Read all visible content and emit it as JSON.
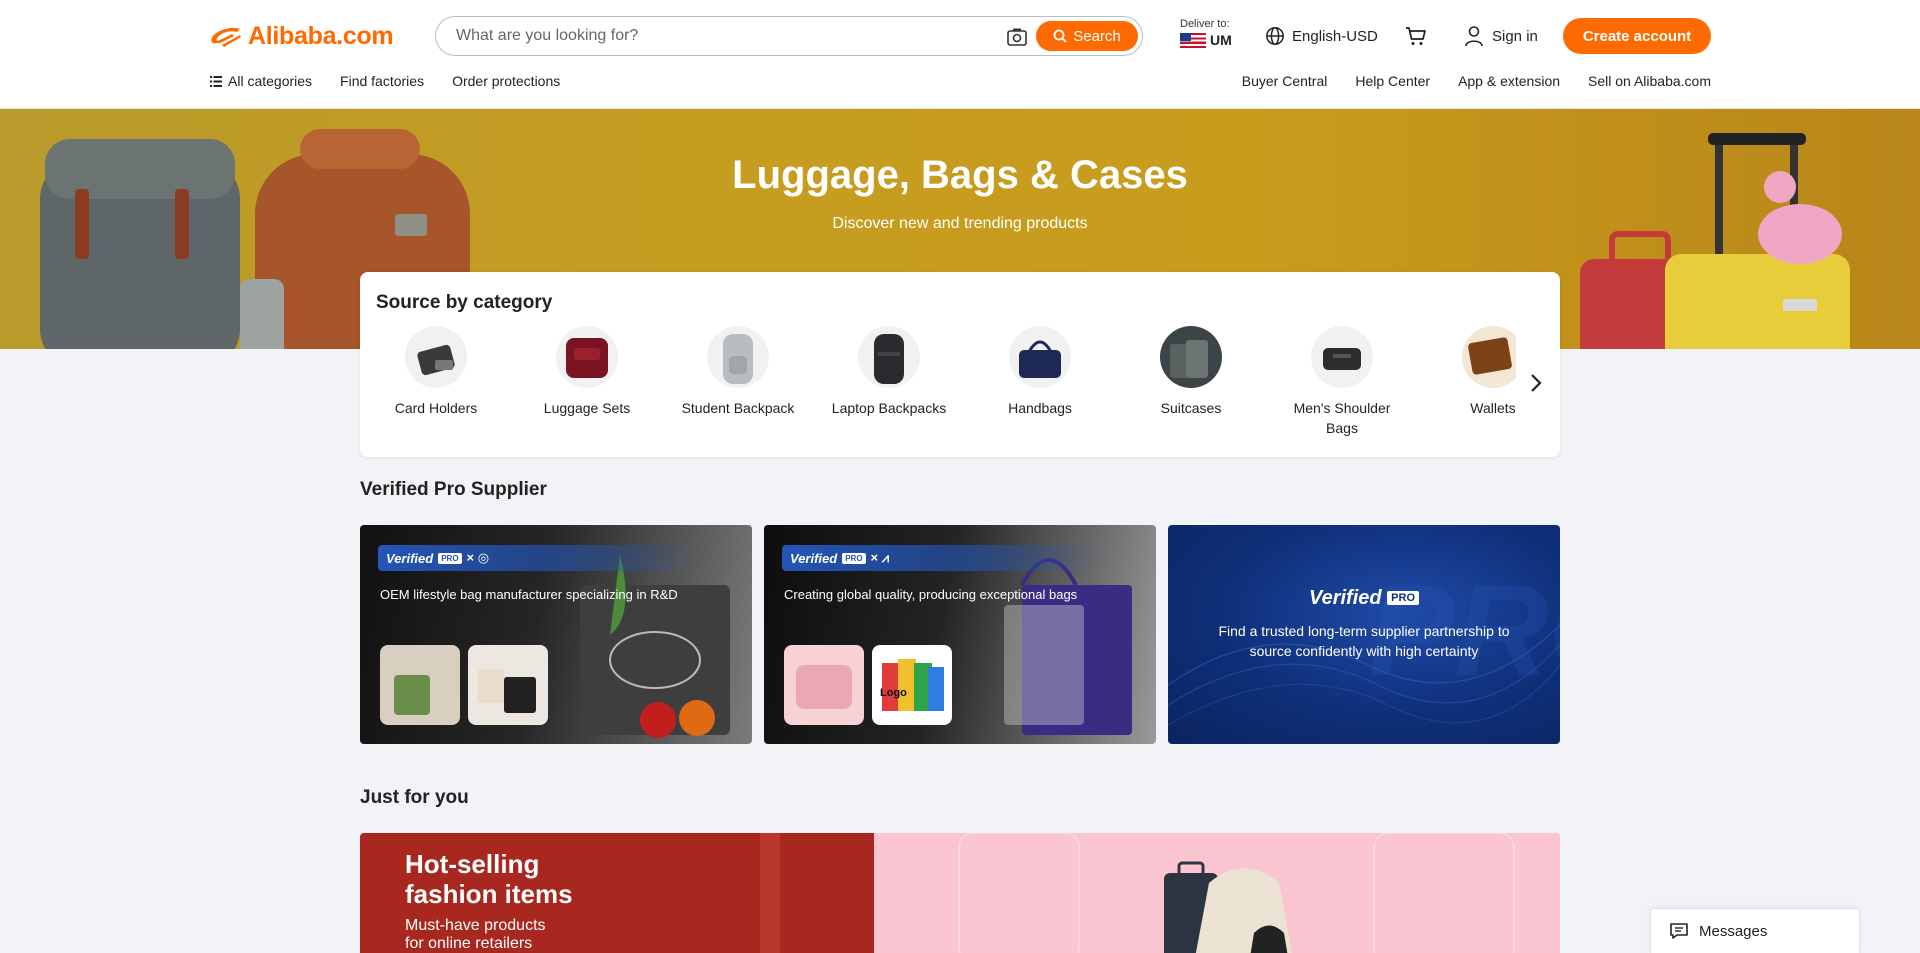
{
  "header": {
    "logo_text": "Alibaba.com",
    "search_placeholder": "What are you looking for?",
    "search_button": "Search",
    "deliver_label": "Deliver to:",
    "deliver_country": "UM",
    "language": "English-USD",
    "sign_in": "Sign in",
    "create_account": "Create account",
    "nav_left": [
      "All categories",
      "Find factories",
      "Order protections"
    ],
    "nav_right": [
      "Buyer Central",
      "Help Center",
      "App & extension",
      "Sell on Alibaba.com"
    ]
  },
  "hero": {
    "title": "Luggage, Bags & Cases",
    "subtitle": "Discover new and trending products"
  },
  "source_by_category": {
    "title": "Source by category",
    "items": [
      {
        "label": "Card Holders",
        "icon": "card-holder"
      },
      {
        "label": "Luggage Sets",
        "icon": "luggage-set"
      },
      {
        "label": "Student Backpack",
        "icon": "student-backpack"
      },
      {
        "label": "Laptop Backpacks",
        "icon": "laptop-backpack"
      },
      {
        "label": "Handbags",
        "icon": "handbag"
      },
      {
        "label": "Suitcases",
        "icon": "suitcase"
      },
      {
        "label": "Men's Shoulder Bags",
        "icon": "shoulder-bag"
      },
      {
        "label": "Wallets",
        "icon": "wallet"
      }
    ]
  },
  "verified_pro": {
    "title": "Verified Pro Supplier",
    "badge_text": "Verified",
    "pro_text": "PRO",
    "cards": [
      {
        "description": "OEM lifestyle bag manufacturer specializing in R&D"
      },
      {
        "description": "Creating global quality, producing exceptional bags"
      }
    ],
    "promo": {
      "logo": "Verified",
      "pro": "PRO",
      "text": "Find a trusted long-term supplier partnership to source confidently with high certainty"
    },
    "thumb_logo": "Logo"
  },
  "just_for_you": {
    "title": "Just for you",
    "banner_title_line1": "Hot-selling",
    "banner_title_line2": "fashion items",
    "banner_sub_line1": "Must-have products",
    "banner_sub_line2": "for online retailers"
  },
  "messages": {
    "label": "Messages"
  },
  "colors": {
    "brand": "#ff6a00",
    "hero_bg": "#c59d21",
    "verified_blue": "#0f2f78"
  }
}
